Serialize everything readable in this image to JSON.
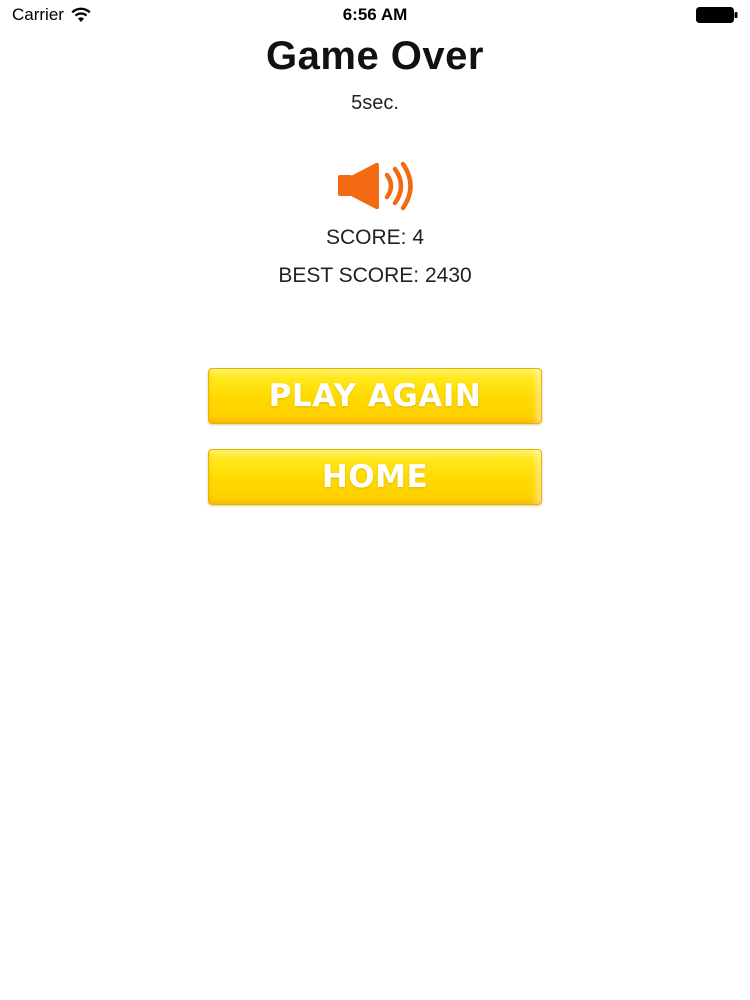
{
  "status_bar": {
    "carrier": "Carrier",
    "time": "6:56 AM",
    "wifi_icon": "wifi-icon",
    "battery_icon": "battery-icon"
  },
  "game_over": {
    "title": "Game Over",
    "time_label": "5sec.",
    "sound_icon": "speaker-icon",
    "score": "SCORE: 4",
    "best_score": "BEST SCORE: 2430"
  },
  "buttons": {
    "play_again_label": "PLAY AGAIN",
    "home_label": "HOME"
  },
  "colors": {
    "button_yellow": "#ffd900",
    "speaker_orange": "#f26a12",
    "text": "#111111",
    "background": "#ffffff"
  }
}
